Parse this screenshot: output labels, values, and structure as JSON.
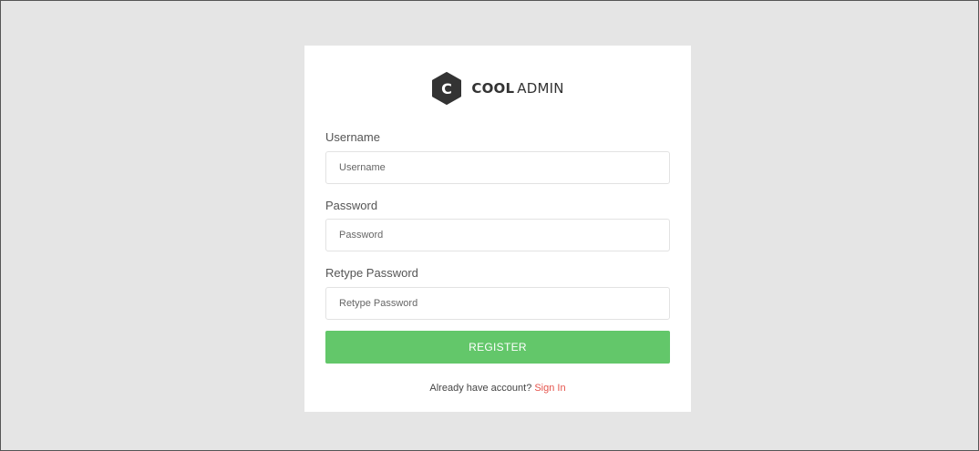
{
  "brand": {
    "logo_letter": "C",
    "name_bold": "COOL",
    "name_light": "ADMIN"
  },
  "form": {
    "username": {
      "label": "Username",
      "placeholder": "Username",
      "value": ""
    },
    "password": {
      "label": "Password",
      "placeholder": "Password",
      "value": ""
    },
    "retype_password": {
      "label": "Retype Password",
      "placeholder": "Retype Password",
      "value": ""
    },
    "submit_label": "REGISTER"
  },
  "footer": {
    "prompt": "Already have account?",
    "link_label": "Sign In"
  },
  "colors": {
    "page_background": "#e5e5e5",
    "card_background": "#ffffff",
    "primary_button": "#63c76a",
    "link": "#e5534b",
    "logo_mark": "#333333"
  },
  "icons": {
    "logo": "hexagon-logo-icon"
  }
}
